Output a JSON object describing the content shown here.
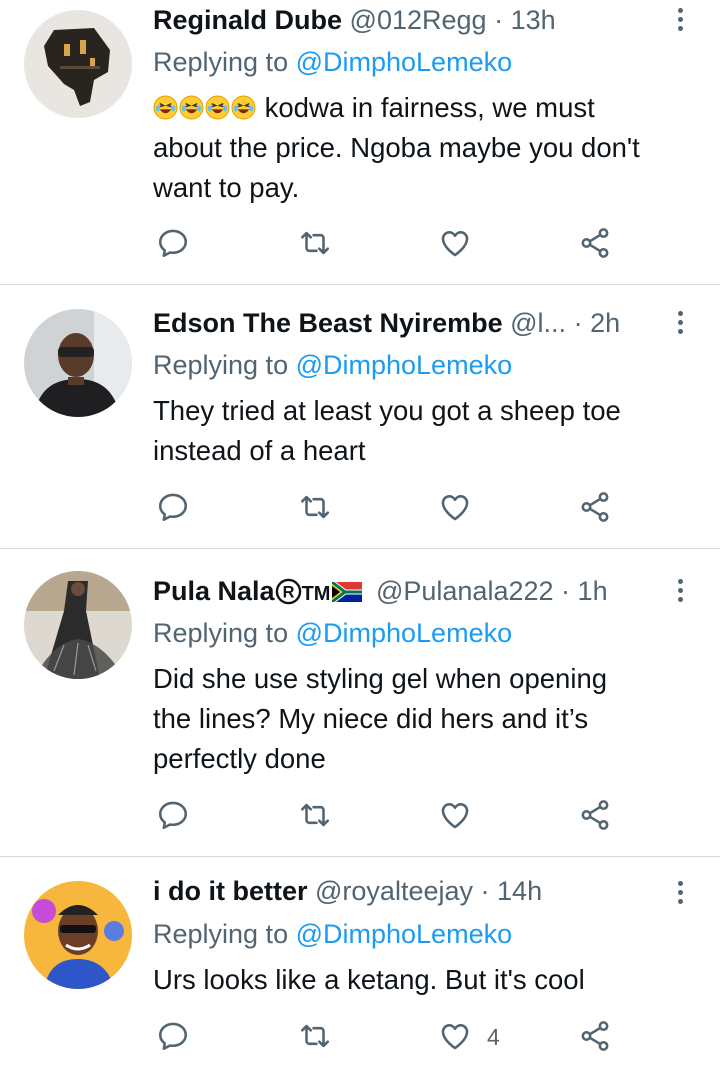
{
  "tweets": [
    {
      "name": "Reginald Dube",
      "handle": "@012Regg",
      "time": "13h",
      "replying_prefix": "Replying to ",
      "replying_to": "@DimphoLemeko",
      "text_line1": "kodwa in fairness, we must",
      "text_line2": "about the price. Ngoba maybe you don't",
      "text_line3": "want to pay.",
      "emoji": "rolling-on-floor-laughing x4",
      "like_count": ""
    },
    {
      "name": "Edson The Beast Nyirembe",
      "handle": "@l...",
      "time": "2h",
      "replying_prefix": "Replying to ",
      "replying_to": "@DimphoLemeko",
      "text_line1": "They tried at least you got a sheep toe",
      "text_line2": "instead of a heart",
      "like_count": ""
    },
    {
      "name": "Pula Nala",
      "name_suffix": "TM",
      "handle": "@Pulanala222",
      "time": "1h",
      "replying_prefix": "Replying to ",
      "replying_to": "@DimphoLemeko",
      "text_line1": "Did she use styling gel when opening",
      "text_line2": "the lines? My niece did hers and it’s",
      "text_line3": "perfectly done",
      "like_count": ""
    },
    {
      "name": "i do it better",
      "handle": "@royalteejay",
      "time": "14h",
      "replying_prefix": "Replying to ",
      "replying_to": "@DimphoLemeko",
      "text_line1": "Urs looks like a ketang. But it's cool",
      "like_count": "4"
    }
  ],
  "separator": "·",
  "icons": [
    "reply-icon",
    "retweet-icon",
    "like-icon",
    "share-icon",
    "more-options-icon"
  ],
  "colors": {
    "text": "#0f1419",
    "secondary": "#536471",
    "mention": "#1d9bf0",
    "divider": "#cfd9de"
  }
}
